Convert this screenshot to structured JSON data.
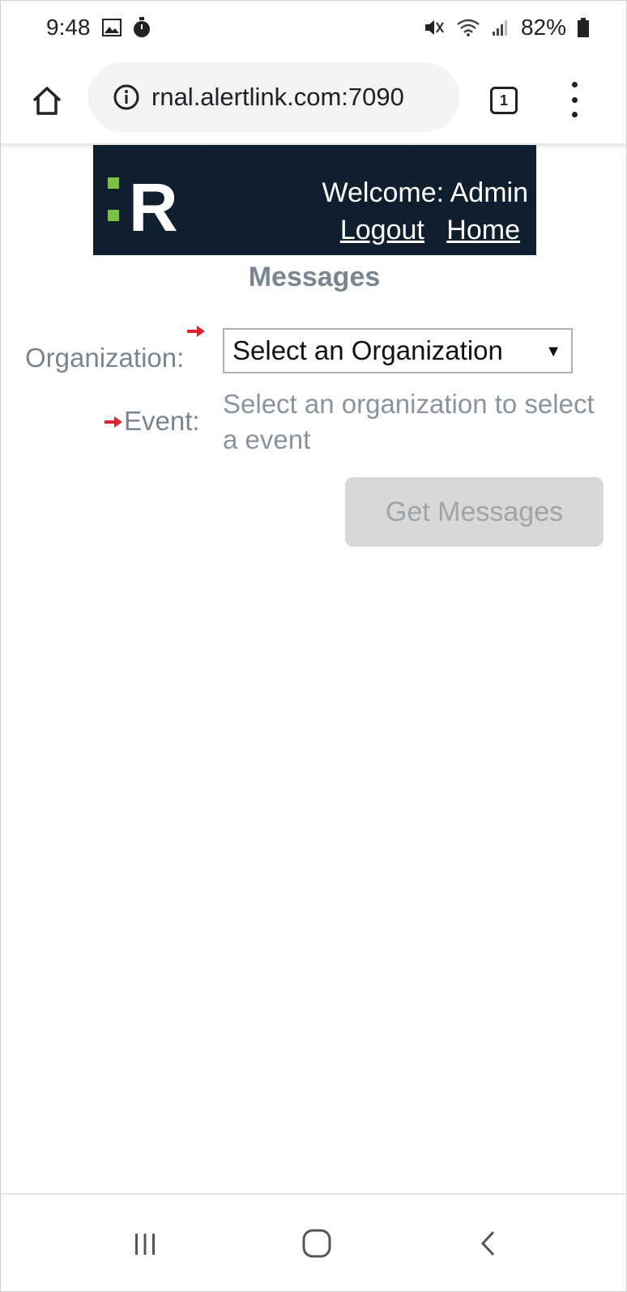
{
  "status_bar": {
    "time": "9:48",
    "battery": "82%"
  },
  "browser": {
    "url": "rnal.alertlink.com:7090",
    "tab_count": "1"
  },
  "header": {
    "logo_text": "R",
    "welcome": "Welcome: Admin",
    "logout_label": "Logout",
    "home_label": "Home"
  },
  "page": {
    "title": "Messages"
  },
  "form": {
    "organization_label": "Organization:",
    "organization_selected": "Select an Organization",
    "event_label": "Event:",
    "event_hint": "Select an organization to select a event",
    "submit_label": "Get Messages"
  },
  "colors": {
    "banner_bg": "#0f1f2e",
    "logo_accent": "#7cc242",
    "required_arrow": "#d9252a",
    "label_gray": "#7a8590"
  }
}
